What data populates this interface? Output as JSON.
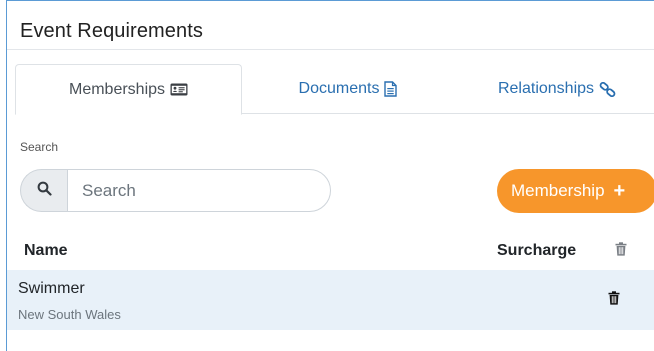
{
  "panel": {
    "title": "Event Requirements"
  },
  "tabs": [
    {
      "label": "Memberships",
      "icon": "id-card-icon",
      "active": true
    },
    {
      "label": "Documents",
      "icon": "document-icon",
      "active": false
    },
    {
      "label": "Relationships",
      "icon": "link-icon",
      "active": false
    }
  ],
  "search": {
    "label": "Search",
    "placeholder": "Search",
    "value": "",
    "icon": "search-icon"
  },
  "add_button": {
    "label": "Membership",
    "icon": "plus-icon"
  },
  "table": {
    "columns": [
      "Name",
      "Surcharge"
    ],
    "header_icon": "trash-icon",
    "rows": [
      {
        "name": "Swimmer",
        "subtitle": "New South Wales",
        "surcharge": "",
        "action_icon": "trash-icon"
      }
    ]
  },
  "colors": {
    "accent": "#f7962b",
    "link": "#2a6fb0",
    "row_highlight": "#e8f1f9",
    "panel_border": "#5b9bd5"
  }
}
